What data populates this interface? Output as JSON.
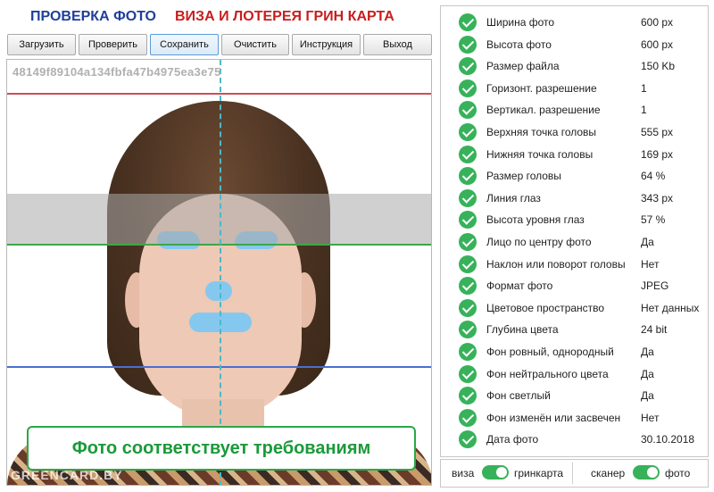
{
  "header": {
    "title_left": "ПРОВЕРКА ФОТО",
    "title_right": "ВИЗА И ЛОТЕРЕЯ ГРИН КАРТА"
  },
  "toolbar": {
    "load": "Загрузить",
    "check": "Проверить",
    "save": "Сохранить",
    "clear": "Очистить",
    "instructions": "Инструкция",
    "exit": "Выход"
  },
  "photo": {
    "hash": "48149f89104a134fbfa47b4975ea3e75",
    "result": "Фото соответствует требованиям",
    "watermark": "GREENCARD.BY"
  },
  "checks": [
    {
      "label": "Ширина фото",
      "value": "600 px"
    },
    {
      "label": "Высота фото",
      "value": "600 px"
    },
    {
      "label": "Размер файла",
      "value": "150 Kb"
    },
    {
      "label": "Горизонт. разрешение",
      "value": "1"
    },
    {
      "label": "Вертикал. разрешение",
      "value": "1"
    },
    {
      "label": "Верхняя точка головы",
      "value": "555 px"
    },
    {
      "label": "Нижняя точка головы",
      "value": "169 px"
    },
    {
      "label": "Размер головы",
      "value": "64 %"
    },
    {
      "label": "Линия глаз",
      "value": "343 px"
    },
    {
      "label": "Высота уровня глаз",
      "value": "57 %"
    },
    {
      "label": "Лицо по центру фото",
      "value": "Да"
    },
    {
      "label": "Наклон или поворот головы",
      "value": "Нет"
    },
    {
      "label": "Формат фото",
      "value": "JPEG"
    },
    {
      "label": "Цветовое пространство",
      "value": "Нет данных"
    },
    {
      "label": "Глубина цвета",
      "value": "24 bit"
    },
    {
      "label": "Фон ровный, однородный",
      "value": "Да"
    },
    {
      "label": "Фон нейтрального цвета",
      "value": "Да"
    },
    {
      "label": "Фон светлый",
      "value": "Да"
    },
    {
      "label": "Фон изменён или засвечен",
      "value": "Нет"
    },
    {
      "label": "Дата фото",
      "value": "30.10.2018"
    }
  ],
  "footer": {
    "mode_left": "виза",
    "mode_right": "гринкарта",
    "source_left": "сканер",
    "source_right": "фото"
  },
  "colors": {
    "accent_green": "#37b25a",
    "title_blue": "#1f3f9b",
    "title_red": "#c81e1e"
  }
}
